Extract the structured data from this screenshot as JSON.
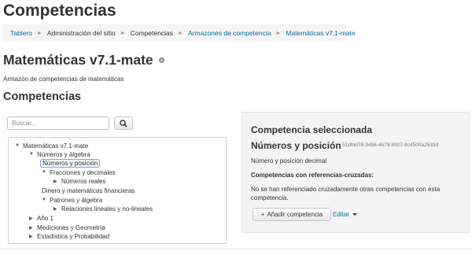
{
  "page": {
    "heading": "Competencias"
  },
  "breadcrumb": [
    {
      "label": "Tablero",
      "link": true
    },
    {
      "label": "Administración del sitio",
      "link": false
    },
    {
      "label": "Competencias",
      "link": false
    },
    {
      "label": "Armazones de competencia",
      "link": true
    },
    {
      "label": "Matemáticas v7.1-mate",
      "link": true
    }
  ],
  "breadcrumb_separator": "►",
  "framework": {
    "title": "Matemáticas v7.1-mate",
    "description": "Armazón de competencias de matemáticas"
  },
  "competencies_section": {
    "title": "Competencias"
  },
  "search": {
    "placeholder": "Buscar...",
    "value": ""
  },
  "tree": {
    "items": [
      {
        "label": "Matemáticas v7.1-mate",
        "arrow": "▼"
      },
      {
        "label": "Números y álgebra",
        "arrow": "▼"
      },
      {
        "label": "Números y posición",
        "arrow": ""
      },
      {
        "label": "Fracciones y decimales",
        "arrow": "▼"
      },
      {
        "label": "Números reales",
        "arrow": "▶"
      },
      {
        "label": "Dinero y matemáticas financieras",
        "arrow": ""
      },
      {
        "label": "Patrones y álgebra",
        "arrow": "▼"
      },
      {
        "label": "Relaciones lineales y no-lineales",
        "arrow": "▶"
      },
      {
        "label": "Año 1",
        "arrow": "▶"
      },
      {
        "label": "Mediciones y Geometría",
        "arrow": "▶"
      },
      {
        "label": "Estadística y Probabilidad",
        "arrow": "▶"
      }
    ],
    "selected": "Números y posición"
  },
  "selected_panel": {
    "heading": "Competencia seleccionada",
    "name": "Números y posición",
    "idnumber": "51dfdd78-3496-4679-8927-8c4500a2533d",
    "description": "Número y posición decimal",
    "cross_heading": "Competencias con referencias-cruzadas:",
    "cross_text": "No se han referenciado cruzadamente otras competencias con esta competencia.",
    "add_button": "Añadir competencia",
    "add_icon": "+",
    "edit_label": "Editar"
  },
  "colors": {
    "link": "#0070a8",
    "panel_bg": "#f4f4f4",
    "breadcrumb_bg": "#f5f5f5"
  },
  "icons": [
    "gear-icon",
    "search-icon",
    "plus-icon",
    "caret-down-icon",
    "expand-arrow-icon",
    "collapse-arrow-icon"
  ]
}
